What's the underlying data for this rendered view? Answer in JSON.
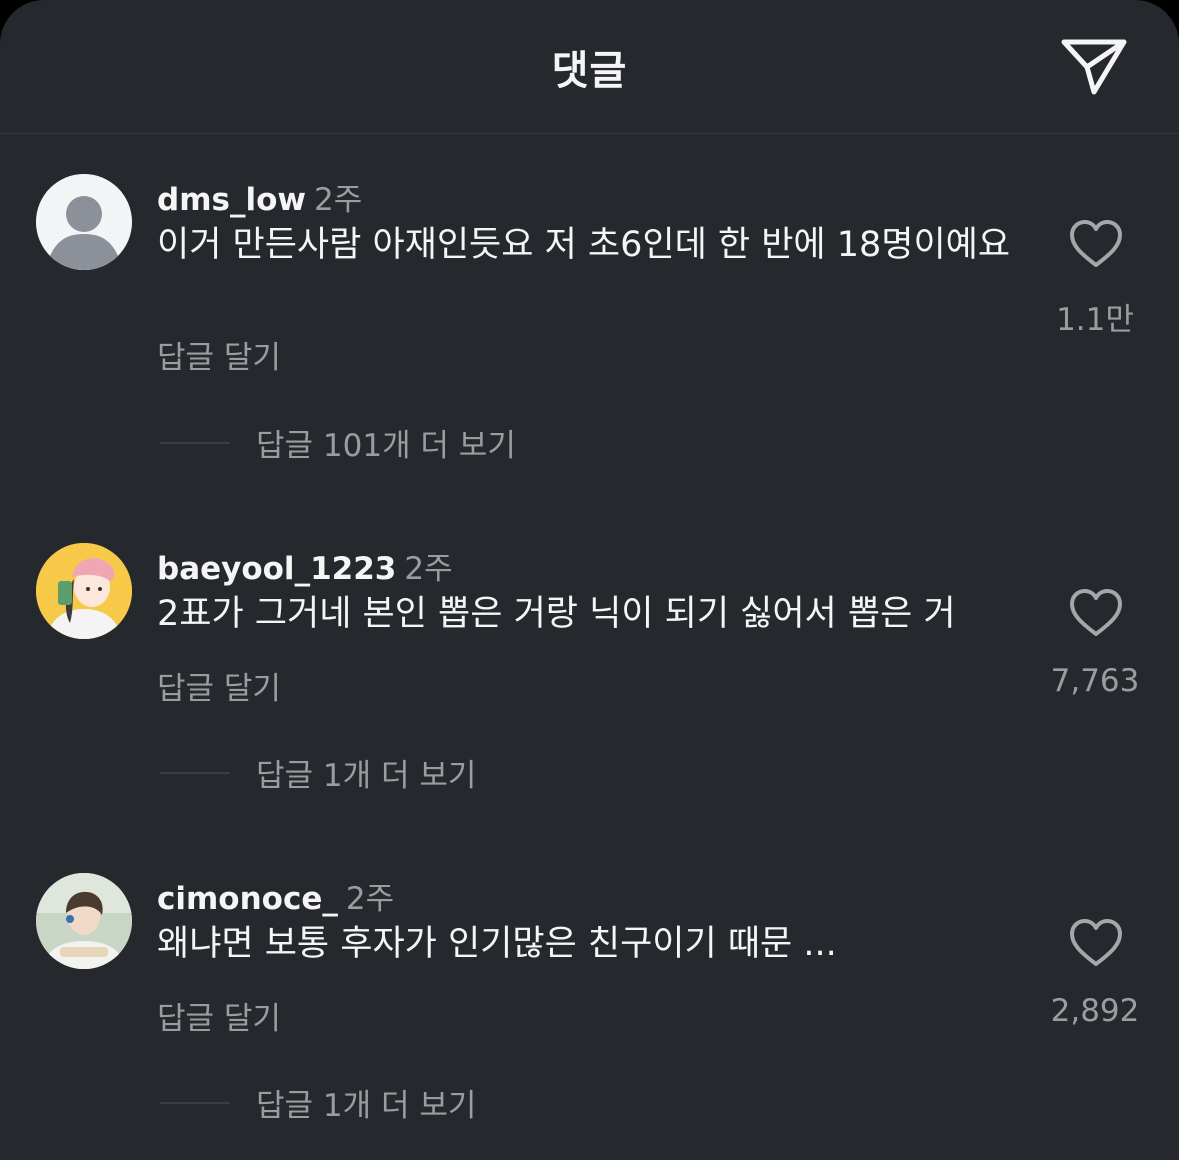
{
  "header": {
    "title": "댓글",
    "share_icon": "paper-plane-icon"
  },
  "comments": [
    {
      "username": "dms_low",
      "time": "2주",
      "text": "이거 만든사람 아재인듯요 저 초6인데 한 반에 18명이예요",
      "reply_label": "답글 달기",
      "like_count": "1.1만",
      "view_replies": "답글 101개 더 보기",
      "avatar": "default-avatar-icon"
    },
    {
      "username": "baeyool_1223",
      "time": "2주",
      "text": "2표가 그거네 본인 뽑은 거랑 닉이 되기 싫어서 뽑은 거",
      "reply_label": "답글 달기",
      "like_count": "7,763",
      "view_replies": "답글 1개 더 보기",
      "avatar": "illustrated-avatar"
    },
    {
      "username": "cimonoce_",
      "time": "2주",
      "text": "왜냐면 보통 후자가 인기많은 친구이기 때문 ...",
      "reply_label": "답글 달기",
      "like_count": "2,892",
      "view_replies": "답글 1개 더 보기",
      "avatar": "photo-avatar"
    }
  ],
  "colors": {
    "background": "#25282d",
    "text_primary": "#f5f5f5",
    "text_secondary": "#9a9ca0"
  }
}
